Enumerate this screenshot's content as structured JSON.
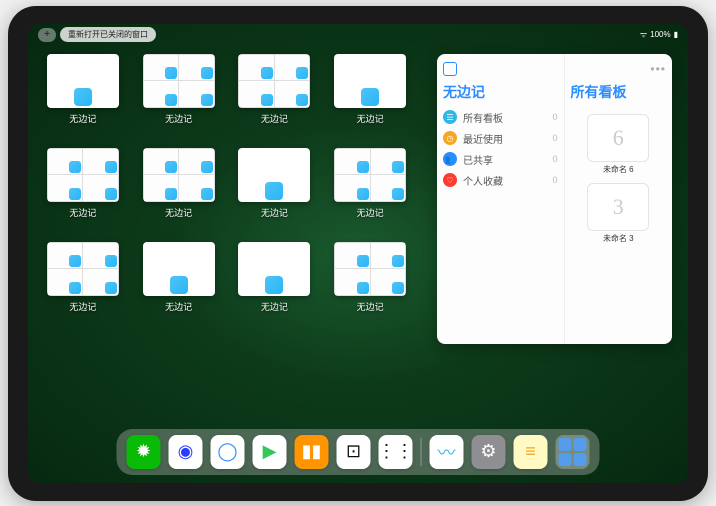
{
  "statusbar": {
    "battery": "100%"
  },
  "topbar": {
    "plus": "+",
    "reopen_label": "重新打开已关闭的窗口"
  },
  "thumbnails": [
    {
      "style": "blank",
      "label": "无边记"
    },
    {
      "style": "tiles",
      "label": "无边记"
    },
    {
      "style": "tiles",
      "label": "无边记"
    },
    {
      "style": "blank",
      "label": "无边记"
    },
    {
      "style": "tiles",
      "label": "无边记"
    },
    {
      "style": "tiles",
      "label": "无边记"
    },
    {
      "style": "blank",
      "label": "无边记"
    },
    {
      "style": "tiles",
      "label": "无边记"
    },
    {
      "style": "tiles",
      "label": "无边记"
    },
    {
      "style": "blank",
      "label": "无边记"
    },
    {
      "style": "blank",
      "label": "无边记"
    },
    {
      "style": "tiles",
      "label": "无边记"
    }
  ],
  "panel": {
    "left_title": "无边记",
    "right_title": "所有看板",
    "categories": [
      {
        "icon": "☰",
        "color": "#2fb8e6",
        "label": "所有看板",
        "count": "0"
      },
      {
        "icon": "◷",
        "color": "#f5a623",
        "label": "最近使用",
        "count": "0"
      },
      {
        "icon": "👥",
        "color": "#2b8cff",
        "label": "已共享",
        "count": "0"
      },
      {
        "icon": "♡",
        "color": "#ff3b30",
        "label": "个人收藏",
        "count": "0"
      }
    ],
    "boards": [
      {
        "glyph": "6",
        "name": "未命名 6",
        "sub": ""
      },
      {
        "glyph": "3",
        "name": "未命名 3",
        "sub": ""
      }
    ]
  },
  "dock": {
    "apps": [
      {
        "name": "wechat",
        "bg": "#09bb07",
        "glyph": "✹"
      },
      {
        "name": "quark-hd",
        "bg": "#ffffff",
        "glyph": "◉",
        "fg": "#2b3bff"
      },
      {
        "name": "quark",
        "bg": "#ffffff",
        "glyph": "◯",
        "fg": "#2b8cff"
      },
      {
        "name": "play",
        "bg": "#ffffff",
        "glyph": "▶",
        "fg": "#34c759"
      },
      {
        "name": "books",
        "bg": "#ff9500",
        "glyph": "▮▮"
      },
      {
        "name": "dice",
        "bg": "#ffffff",
        "glyph": "⊡",
        "fg": "#111"
      },
      {
        "name": "nodes",
        "bg": "#ffffff",
        "glyph": "⋮⋮",
        "fg": "#111"
      },
      {
        "name": "freeform",
        "bg": "#ffffff",
        "glyph": "〰",
        "fg": "#2fb8e6"
      },
      {
        "name": "settings",
        "bg": "#8e8e93",
        "glyph": "⚙"
      },
      {
        "name": "notes",
        "bg": "#fff9c4",
        "glyph": "≡",
        "fg": "#f5a623"
      }
    ]
  }
}
